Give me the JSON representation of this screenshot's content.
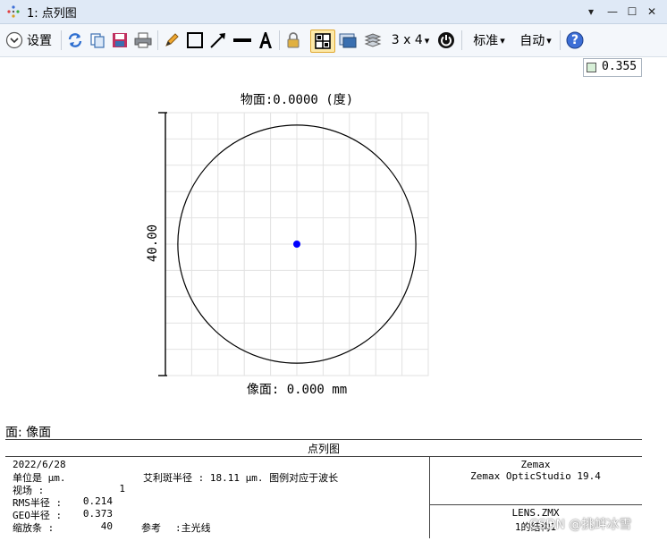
{
  "window": {
    "title": "1: 点列图",
    "pin_glyph": "▾",
    "min_glyph": "—",
    "max_glyph": "☐",
    "close_glyph": "✕"
  },
  "toolbar": {
    "settings_label": "设置",
    "layout_label": "3 x 4",
    "standard_label": "标准",
    "auto_label": "自动",
    "dropdown_glyph": "▾",
    "help_glyph": "?"
  },
  "colors": {
    "accent": "#3c6ed6",
    "spot": "#0000ff",
    "grid": "#e2e2e2"
  },
  "plot": {
    "title": "物面:0.0000 (度)",
    "scale_label": "40.00",
    "xlabel": "像面: 0.000 mm",
    "field_value": "0.355"
  },
  "chart_data": {
    "type": "scatter",
    "title": "物面:0.0000 (度)",
    "xlabel": "像面: 0.000 mm",
    "ylabel": "40.00",
    "grid": true,
    "xlim": [
      -20,
      20
    ],
    "ylim": [
      -20,
      20
    ],
    "airy_radius": 18.11,
    "series": [
      {
        "x": [
          0
        ],
        "y": [
          0
        ]
      }
    ]
  },
  "info": {
    "surface_label": "面: 像面",
    "panel_title": "点列图",
    "date": "2022/6/28",
    "units": "单位是 µm.",
    "airy": "艾利斑半径 : 18.11 µm. 图例对应于波长",
    "field_label": "视场   :",
    "field_value": "1",
    "rms_label": "RMS半径 :",
    "rms_value": "0.214",
    "geo_label": "GEO半径 :",
    "geo_value": "0.373",
    "scale_label": "缩放条  :",
    "scale_value": "40",
    "ref_label": "参考",
    "ref_value": ":主光线",
    "brand": "Zemax",
    "product": "Zemax OpticStudio 19.4",
    "file": "LENS.ZMX",
    "config": "1的结构1"
  },
  "watermark": "CSDN @挑衅冰雪"
}
